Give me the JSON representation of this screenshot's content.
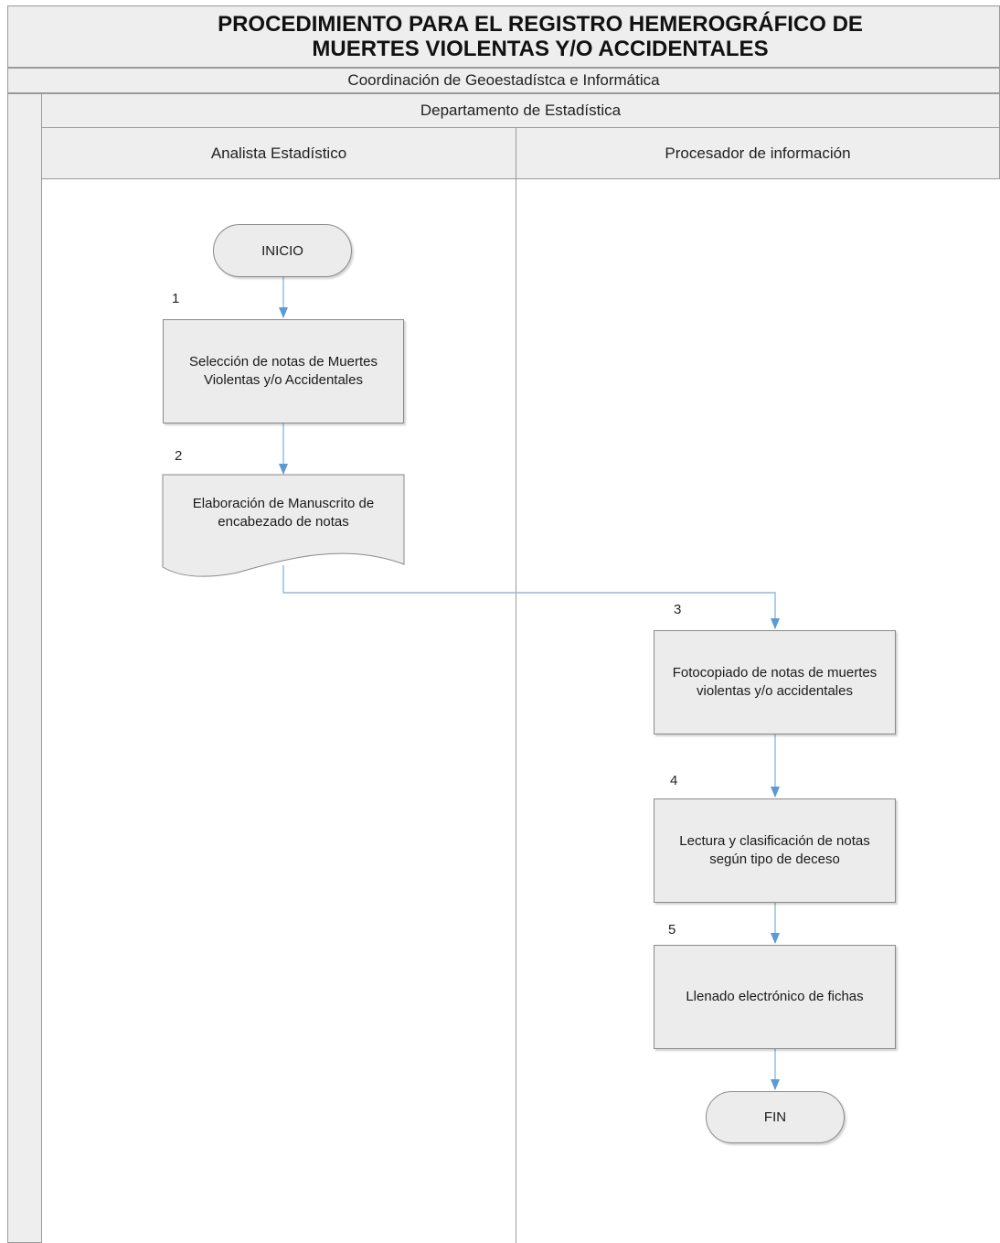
{
  "header": {
    "title": "PROCEDIMIENTO PARA EL REGISTRO HEMEROGRÁFICO DE MUERTES VIOLENTAS Y/O ACCIDENTALES",
    "coordination": "Coordinación de Geoestadístca e Informática",
    "department": "Departamento de Estadística"
  },
  "lanes": [
    {
      "label": "Analista Estadístico"
    },
    {
      "label": "Procesador de información"
    }
  ],
  "steps": [
    {
      "number": "1",
      "text": "Selección de notas de Muertes Violentas y/o Accidentales"
    },
    {
      "number": "2",
      "text": "Elaboración de Manuscrito de encabezado de notas"
    },
    {
      "number": "3",
      "text": "Fotocopiado de notas de muertes violentas y/o accidentales"
    },
    {
      "number": "4",
      "text": "Lectura y clasificación de notas según tipo de deceso"
    },
    {
      "number": "5",
      "text": "Llenado electrónico de fichas"
    }
  ],
  "terminals": {
    "start": "INICIO",
    "end": "FIN"
  },
  "colors": {
    "shape_fill": "#ececec",
    "arrow": "#5b9bd5",
    "band": "#eeeeee",
    "border": "#9a9a9a"
  }
}
